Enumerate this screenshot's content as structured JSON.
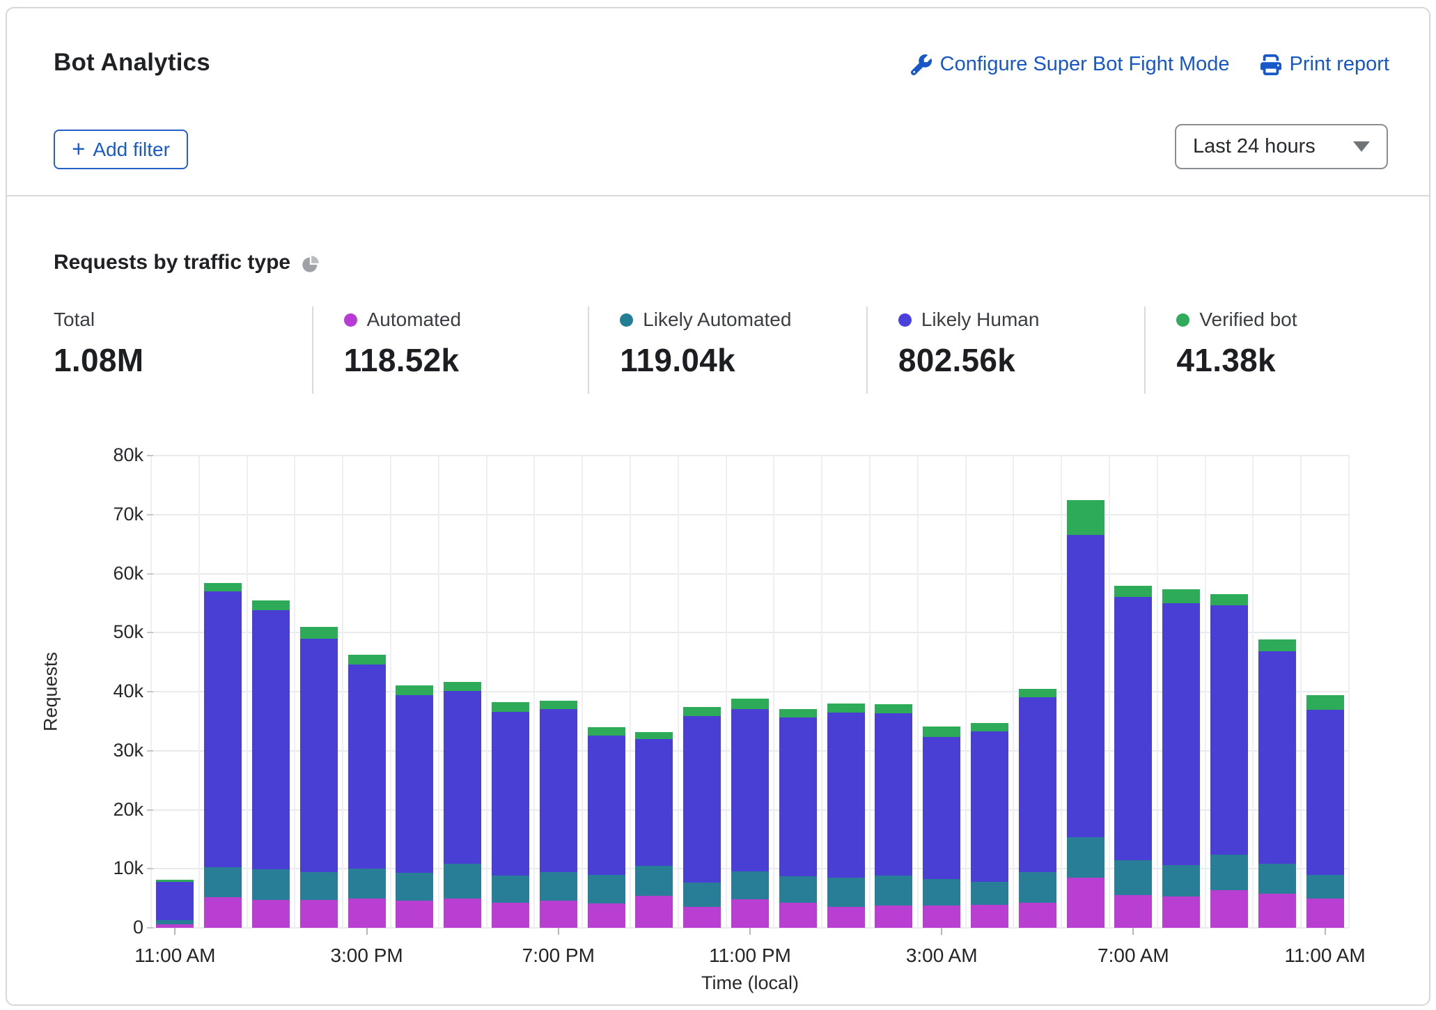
{
  "header": {
    "title": "Bot Analytics",
    "configure_link": "Configure Super Bot Fight Mode",
    "print_link": "Print report",
    "add_filter": {
      "icon_glyph": "+",
      "label": "Add filter"
    },
    "time_range_selected": "Last 24 hours"
  },
  "section": {
    "title": "Requests by traffic type"
  },
  "stats": [
    {
      "label": "Total",
      "value": "1.08M",
      "dot_color": null
    },
    {
      "label": "Automated",
      "value": "118.52k",
      "dot_color": "#b93bd6"
    },
    {
      "label": "Likely Automated",
      "value": "119.04k",
      "dot_color": "#217e95"
    },
    {
      "label": "Likely Human",
      "value": "802.56k",
      "dot_color": "#4a41dc"
    },
    {
      "label": "Verified bot",
      "value": "41.38k",
      "dot_color": "#2eac5a"
    }
  ],
  "colors": {
    "automated": "#b83fd2",
    "likely_automated": "#277e96",
    "likely_human": "#4a3fd4",
    "verified_bot": "#2eab58",
    "link_blue": "#1757c8",
    "grid": "#e9eaec"
  },
  "chart_data": {
    "type": "bar",
    "stacked": true,
    "title": "Requests by traffic type",
    "xlabel": "Time (local)",
    "ylabel": "Requests",
    "value_unit": "thousands of requests",
    "ylim": [
      0,
      80
    ],
    "ytick_labels": [
      "80k",
      "70k",
      "60k",
      "50k",
      "40k",
      "30k",
      "20k",
      "10k",
      "0"
    ],
    "x_tick_every": 4,
    "categories": [
      "11:00 AM",
      "12:00 PM",
      "1:00 PM",
      "2:00 PM",
      "3:00 PM",
      "4:00 PM",
      "5:00 PM",
      "6:00 PM",
      "7:00 PM",
      "8:00 PM",
      "9:00 PM",
      "10:00 PM",
      "11:00 PM",
      "12:00 AM",
      "1:00 AM",
      "2:00 AM",
      "3:00 AM",
      "4:00 AM",
      "5:00 AM",
      "6:00 AM",
      "7:00 AM",
      "8:00 AM",
      "9:00 AM",
      "10:00 AM",
      "11:00 AM"
    ],
    "series": [
      {
        "name": "Automated",
        "color": "#b83fd2",
        "values": [
          0.6,
          5.2,
          4.7,
          4.7,
          4.9,
          4.6,
          4.9,
          4.2,
          4.6,
          4.1,
          5.4,
          3.6,
          4.8,
          4.2,
          3.6,
          3.8,
          3.8,
          3.9,
          4.2,
          8.5,
          5.5,
          5.3,
          6.4,
          5.8,
          4.9
        ]
      },
      {
        "name": "Likely Automated",
        "color": "#277e96",
        "values": [
          0.7,
          5.1,
          5.2,
          4.8,
          5.1,
          4.7,
          5.9,
          4.7,
          4.8,
          4.9,
          5.1,
          4.1,
          4.8,
          4.5,
          4.9,
          5.0,
          4.5,
          3.9,
          5.3,
          6.8,
          6.0,
          5.3,
          6.0,
          5.1,
          4.1
        ]
      },
      {
        "name": "Likely Human",
        "color": "#4a3fd4",
        "values": [
          6.5,
          46.7,
          43.9,
          39.5,
          34.6,
          30.1,
          29.3,
          27.7,
          27.6,
          23.6,
          21.5,
          28.2,
          27.4,
          26.9,
          28.0,
          27.6,
          24.0,
          25.5,
          29.6,
          51.2,
          44.5,
          44.4,
          42.2,
          35.9,
          27.9
        ]
      },
      {
        "name": "Verified bot",
        "color": "#2eab58",
        "values": [
          0.3,
          1.4,
          1.7,
          2.0,
          1.6,
          1.7,
          1.6,
          1.6,
          1.5,
          1.4,
          1.2,
          1.5,
          1.8,
          1.5,
          1.5,
          1.5,
          1.8,
          1.4,
          1.4,
          6.0,
          1.9,
          2.4,
          1.9,
          2.1,
          2.5
        ]
      }
    ]
  }
}
